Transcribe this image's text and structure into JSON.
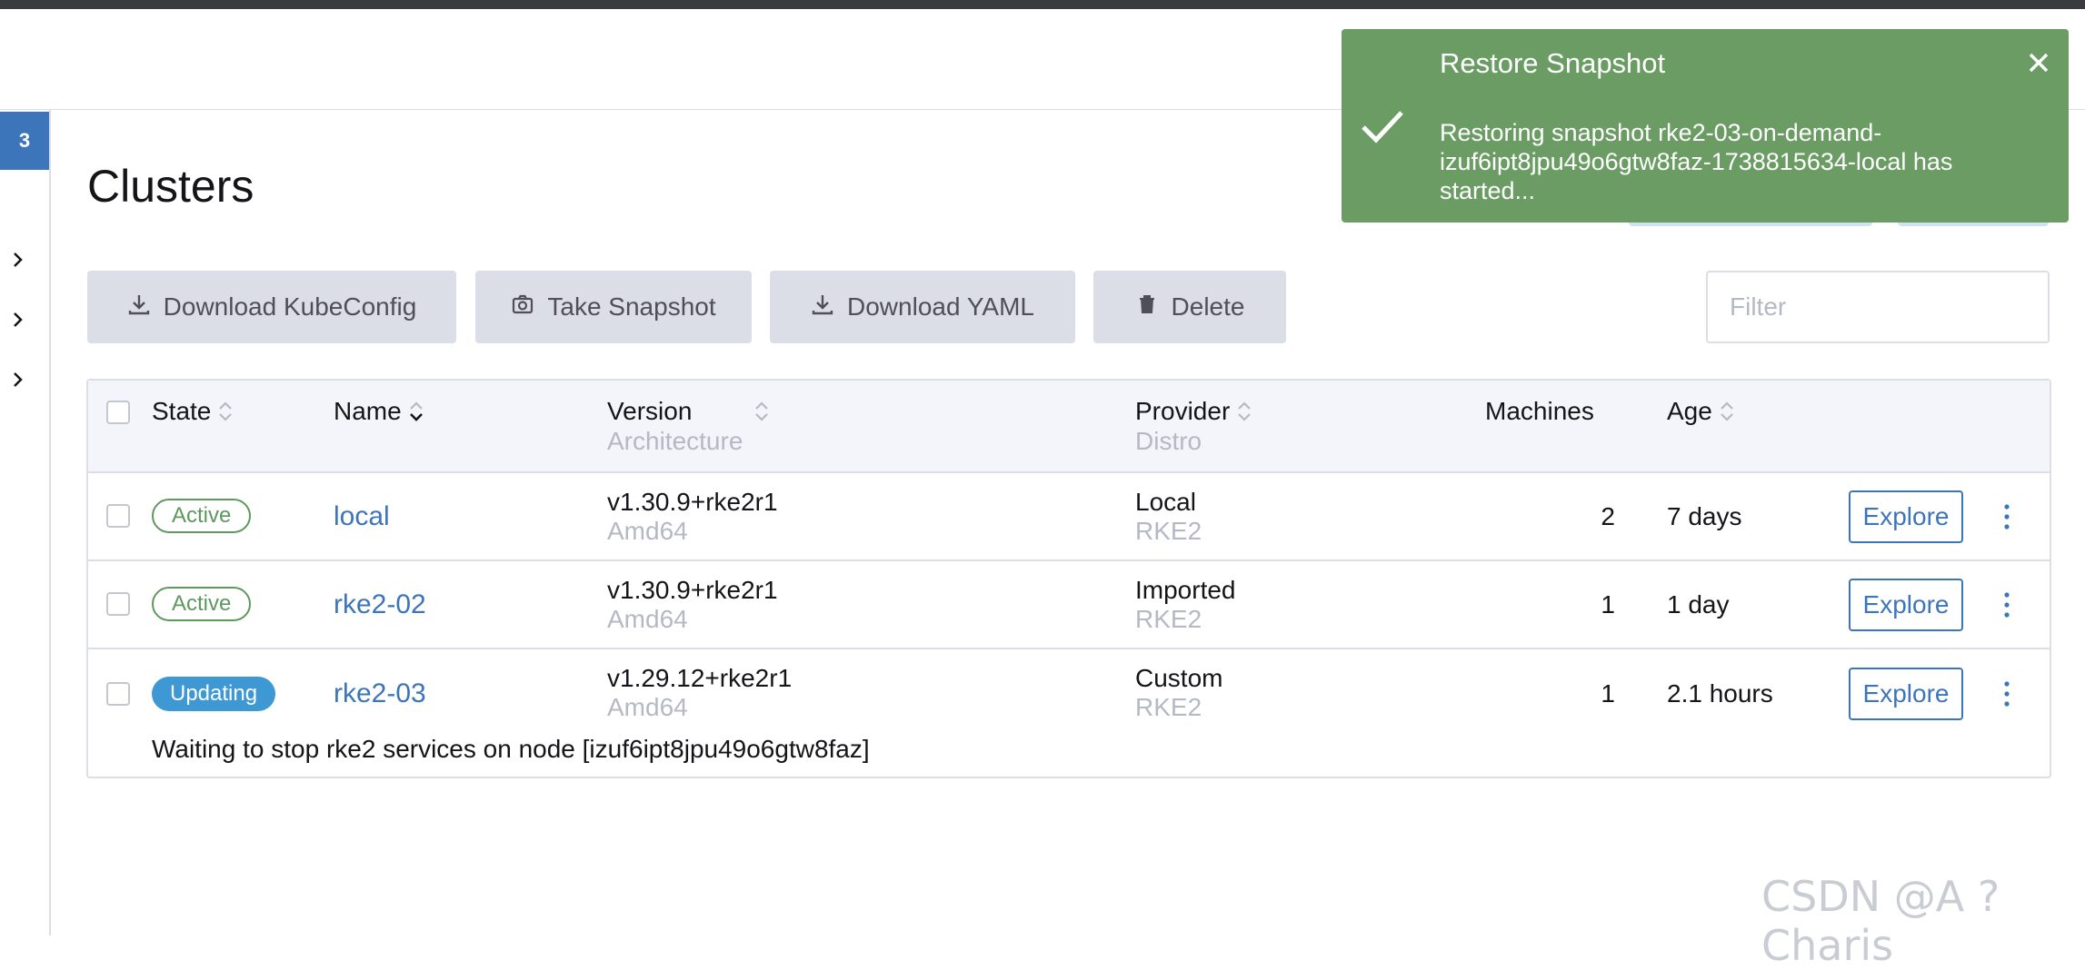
{
  "left_rail": {
    "badge": "3"
  },
  "page": {
    "title": "Clusters"
  },
  "toolbar": {
    "download_kubeconfig": "Download KubeConfig",
    "take_snapshot": "Take Snapshot",
    "download_yaml": "Download YAML",
    "delete": "Delete",
    "filter_placeholder": "Filter"
  },
  "table": {
    "headers": {
      "state": "State",
      "name": "Name",
      "version": "Version",
      "version_sub": "Architecture",
      "provider": "Provider",
      "provider_sub": "Distro",
      "machines": "Machines",
      "age": "Age"
    },
    "rows": [
      {
        "state": "Active",
        "name": "local",
        "version": "v1.30.9+rke2r1",
        "arch": "Amd64",
        "provider": "Local",
        "distro": "RKE2",
        "machines": "2",
        "age": "7 days",
        "action": "Explore"
      },
      {
        "state": "Active",
        "name": "rke2-02",
        "version": "v1.30.9+rke2r1",
        "arch": "Amd64",
        "provider": "Imported",
        "distro": "RKE2",
        "machines": "1",
        "age": "1 day",
        "action": "Explore"
      },
      {
        "state": "Updating",
        "name": "rke2-03",
        "version": "v1.29.12+rke2r1",
        "arch": "Amd64",
        "provider": "Custom",
        "distro": "RKE2",
        "machines": "1",
        "age": "2.1 hours",
        "action": "Explore",
        "message": "Waiting to stop rke2 services on node [izuf6ipt8jpu49o6gtw8faz]"
      }
    ]
  },
  "toast": {
    "title": "Restore Snapshot",
    "message": "Restoring snapshot rke2-03-on-demand-izuf6ipt8jpu49o6gtw8faz-1738815634-local has started..."
  },
  "watermark": "CSDN @A ?Charis",
  "colors": {
    "accent": "#3d75bb",
    "success": "#5d995d",
    "toast_bg": "#6a9c64",
    "updating": "#3d98d3",
    "button_bg": "#dcdee7"
  }
}
